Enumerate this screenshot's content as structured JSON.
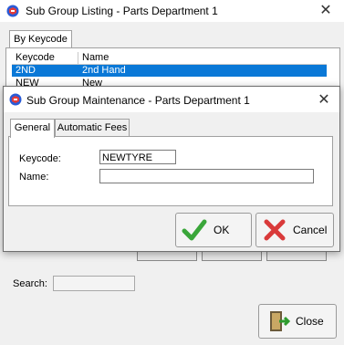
{
  "background_window": {
    "title": "Sub Group Listing - Parts Department 1",
    "close_glyph": "✕",
    "tabs": [
      "By Keycode"
    ],
    "columns": [
      "Keycode",
      "Name"
    ],
    "rows": [
      {
        "keycode": "2ND",
        "name": "2nd Hand",
        "selected": true
      },
      {
        "keycode": "NEW",
        "name": "New",
        "selected": false
      }
    ],
    "search": {
      "label": "Search:",
      "value": ""
    },
    "close_button": {
      "label": "Close",
      "icon": "door-exit-icon"
    }
  },
  "dialog": {
    "title": "Sub Group Maintenance - Parts Department 1",
    "close_glyph": "✕",
    "tabs": [
      {
        "label": "General",
        "active": true
      },
      {
        "label": "Automatic Fees",
        "active": false
      }
    ],
    "fields": {
      "keycode": {
        "label": "Keycode:",
        "value": "NEWTYRE"
      },
      "name": {
        "label": "Name:",
        "value": ""
      }
    },
    "buttons": {
      "ok": {
        "label": "OK",
        "icon": "green-check-icon"
      },
      "cancel": {
        "label": "Cancel",
        "icon": "red-x-icon"
      }
    }
  },
  "colors": {
    "selection": "#0a78d7",
    "window_bg": "#f0f0f0",
    "ok_green": "#3aa63a",
    "cancel_red": "#d93a3a"
  }
}
